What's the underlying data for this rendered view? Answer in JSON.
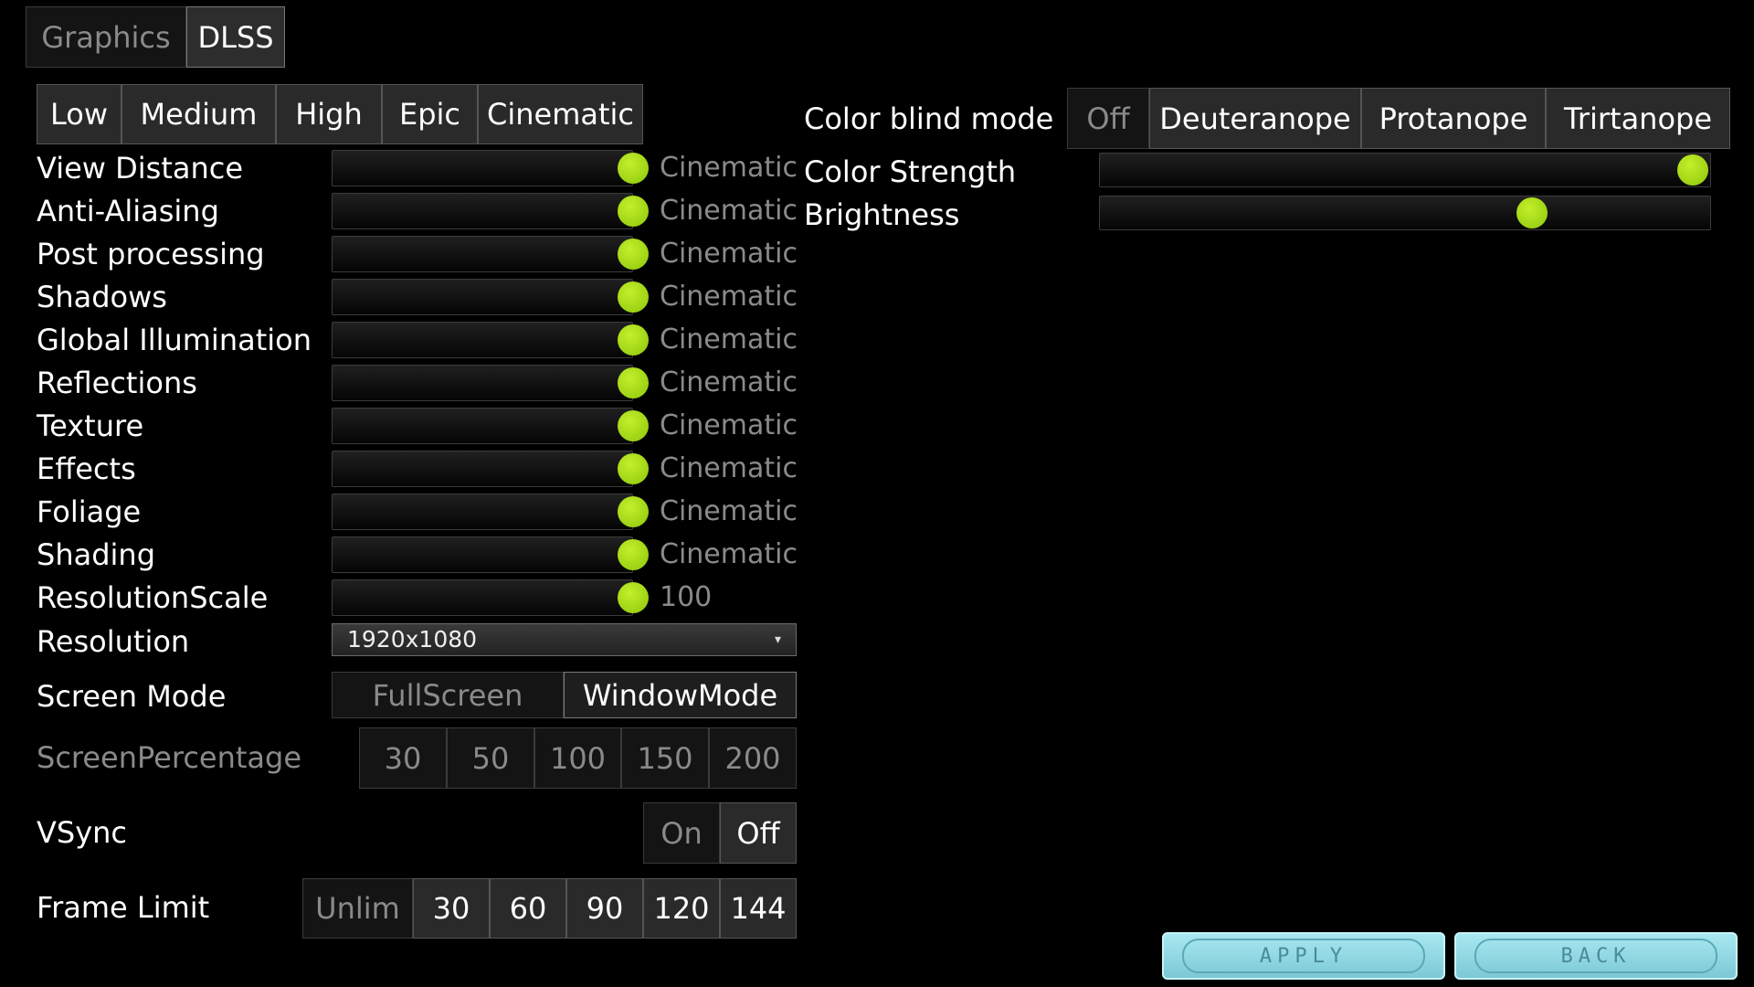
{
  "tabs": [
    {
      "label": "Graphics",
      "active": false
    },
    {
      "label": "DLSS",
      "active": true
    }
  ],
  "presets": [
    "Low",
    "Medium",
    "High",
    "Epic",
    "Cinematic"
  ],
  "settings": [
    {
      "label": "View Distance",
      "value": "Cinematic",
      "level": 1.0
    },
    {
      "label": "Anti-Aliasing",
      "value": "Cinematic",
      "level": 1.0
    },
    {
      "label": "Post processing",
      "value": "Cinematic",
      "level": 1.0
    },
    {
      "label": "Shadows",
      "value": "Cinematic",
      "level": 1.0
    },
    {
      "label": "Global Illumination",
      "value": "Cinematic",
      "level": 1.0
    },
    {
      "label": "Reflections",
      "value": "Cinematic",
      "level": 1.0
    },
    {
      "label": "Texture",
      "value": "Cinematic",
      "level": 1.0
    },
    {
      "label": "Effects",
      "value": "Cinematic",
      "level": 1.0
    },
    {
      "label": "Foliage",
      "value": "Cinematic",
      "level": 1.0
    },
    {
      "label": "Shading",
      "value": "Cinematic",
      "level": 1.0
    },
    {
      "label": "ResolutionScale",
      "value": "100",
      "level": 1.0
    }
  ],
  "resolution": {
    "label": "Resolution",
    "value": "1920x1080"
  },
  "screen_mode": {
    "label": "Screen Mode",
    "options": [
      "FullScreen",
      "WindowMode"
    ],
    "selected": "WindowMode"
  },
  "screen_percentage": {
    "label": "ScreenPercentage",
    "options": [
      "30",
      "50",
      "100",
      "150",
      "200"
    ]
  },
  "vsync": {
    "label": "VSync",
    "options": [
      "On",
      "Off"
    ],
    "selected": "Off"
  },
  "frame_limit": {
    "label": "Frame Limit",
    "options": [
      "Unlim",
      "30",
      "60",
      "90",
      "120",
      "144"
    ]
  },
  "color_blind": {
    "label": "Color blind mode",
    "options": [
      "Off",
      "Deuteranope",
      "Protanope",
      "Trirtanope"
    ],
    "selected_dim": "Off"
  },
  "color_strength": {
    "label": "Color Strength",
    "level": 1.0
  },
  "brightness": {
    "label": "Brightness",
    "level": 0.72
  },
  "footer": {
    "apply": "APPLY",
    "back": "BACK"
  },
  "colors": {
    "accent": "#a6d80f",
    "button_bg": "#2a2a2a",
    "dim_text": "#8a8a8a",
    "bottom_button": "#8fd8e4"
  }
}
